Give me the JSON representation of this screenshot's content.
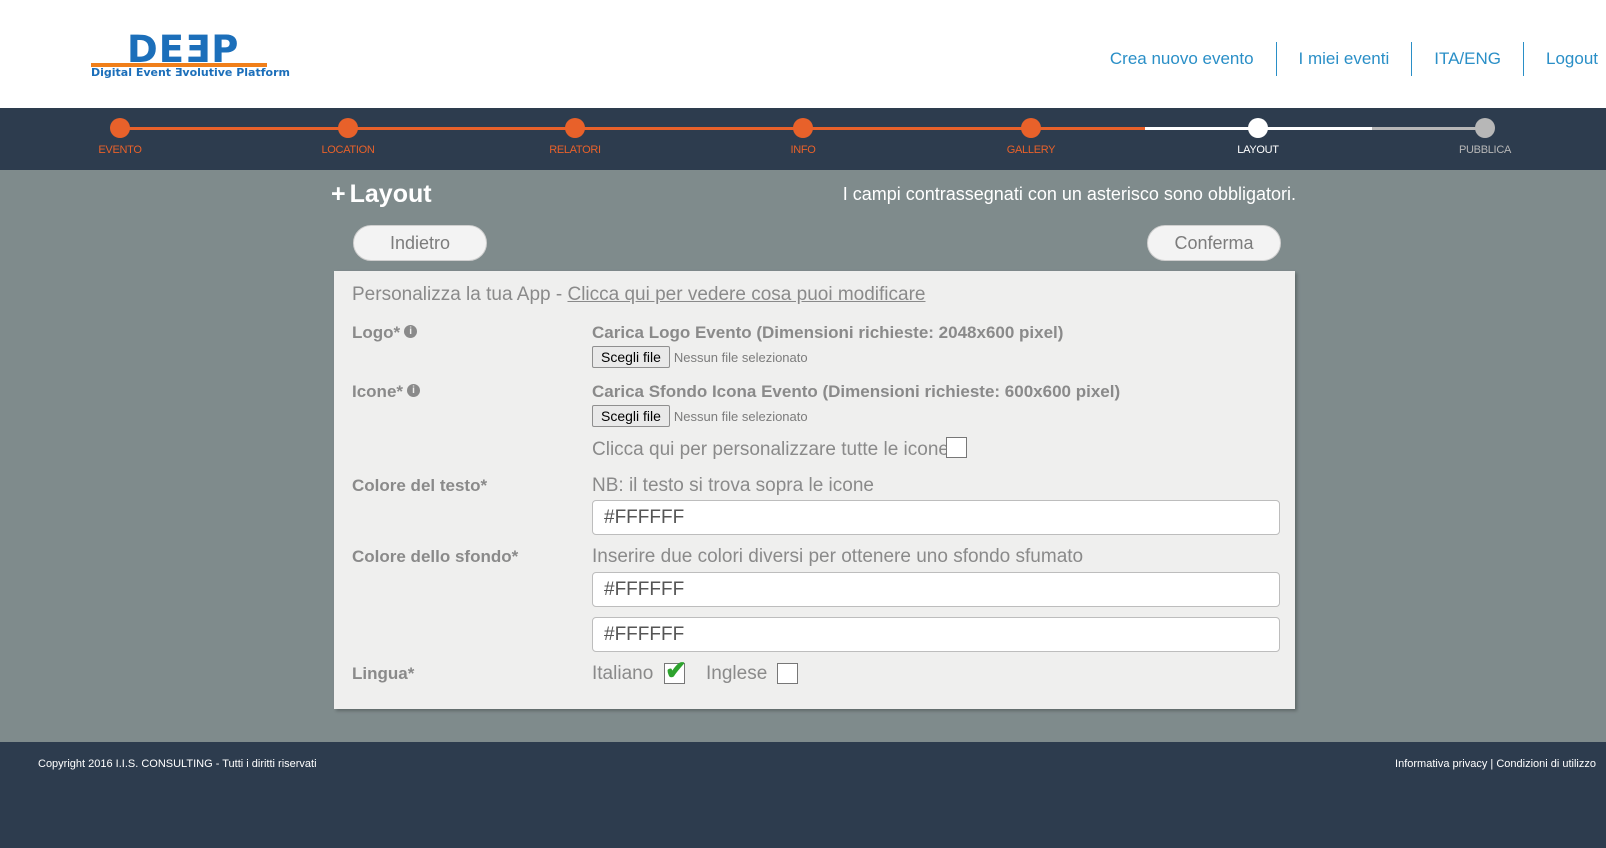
{
  "brand": {
    "logo_word": "DEƎP",
    "tagline": "Digital Event Ǝvolutive Platform"
  },
  "nav": {
    "items": [
      "Crea nuovo evento",
      "I miei eventi",
      "ITA/ENG",
      "Logout"
    ]
  },
  "steps": [
    {
      "label": "EVENTO",
      "state": "done"
    },
    {
      "label": "LOCATION",
      "state": "done"
    },
    {
      "label": "RELATORI",
      "state": "done"
    },
    {
      "label": "INFO",
      "state": "done"
    },
    {
      "label": "GALLERY",
      "state": "done"
    },
    {
      "label": "LAYOUT",
      "state": "current"
    },
    {
      "label": "PUBBLICA",
      "state": "todo"
    }
  ],
  "page": {
    "plus": "+",
    "title": "Layout",
    "required_note": "I campi contrassegnati con un asterisco sono obbligatori.",
    "back_label": "Indietro",
    "confirm_label": "Conferma"
  },
  "form": {
    "intro_prefix": "Personalizza la tua App - ",
    "intro_link": "Clicca qui per vedere cosa puoi modificare",
    "logo": {
      "label": "Logo*",
      "upload_title": "Carica Logo Evento (Dimensioni richieste: 2048x600 pixel)",
      "button": "Scegli file",
      "status": "Nessun file selezionato"
    },
    "icons": {
      "label": "Icone*",
      "upload_title": "Carica Sfondo Icona Evento (Dimensioni richieste: 600x600 pixel)",
      "button": "Scegli file",
      "status": "Nessun file selezionato",
      "customize_label": "Clicca qui per personalizzare tutte le icone",
      "customize_checked": false
    },
    "text_color": {
      "label": "Colore del testo*",
      "note": "NB: il testo si trova sopra le icone",
      "value": "#FFFFFF"
    },
    "bg_color": {
      "label": "Colore dello sfondo*",
      "note": "Inserire due colori diversi per ottenere uno sfondo sfumato",
      "value1": "#FFFFFF",
      "value2": "#FFFFFF"
    },
    "language": {
      "label": "Lingua*",
      "italian": "Italiano",
      "italian_checked": true,
      "english": "Inglese",
      "english_checked": false
    }
  },
  "footer": {
    "copyright": "Copyright 2016 I.I.S. CONSULTING - Tutti i diritti riservati",
    "privacy": "Informativa privacy",
    "separator": " | ",
    "terms": "Condizioni di utilizzo"
  },
  "colors": {
    "accent": "#e8612a",
    "dark": "#2d3c4e",
    "link": "#2a8fc7",
    "background": "#7f8b8c"
  }
}
